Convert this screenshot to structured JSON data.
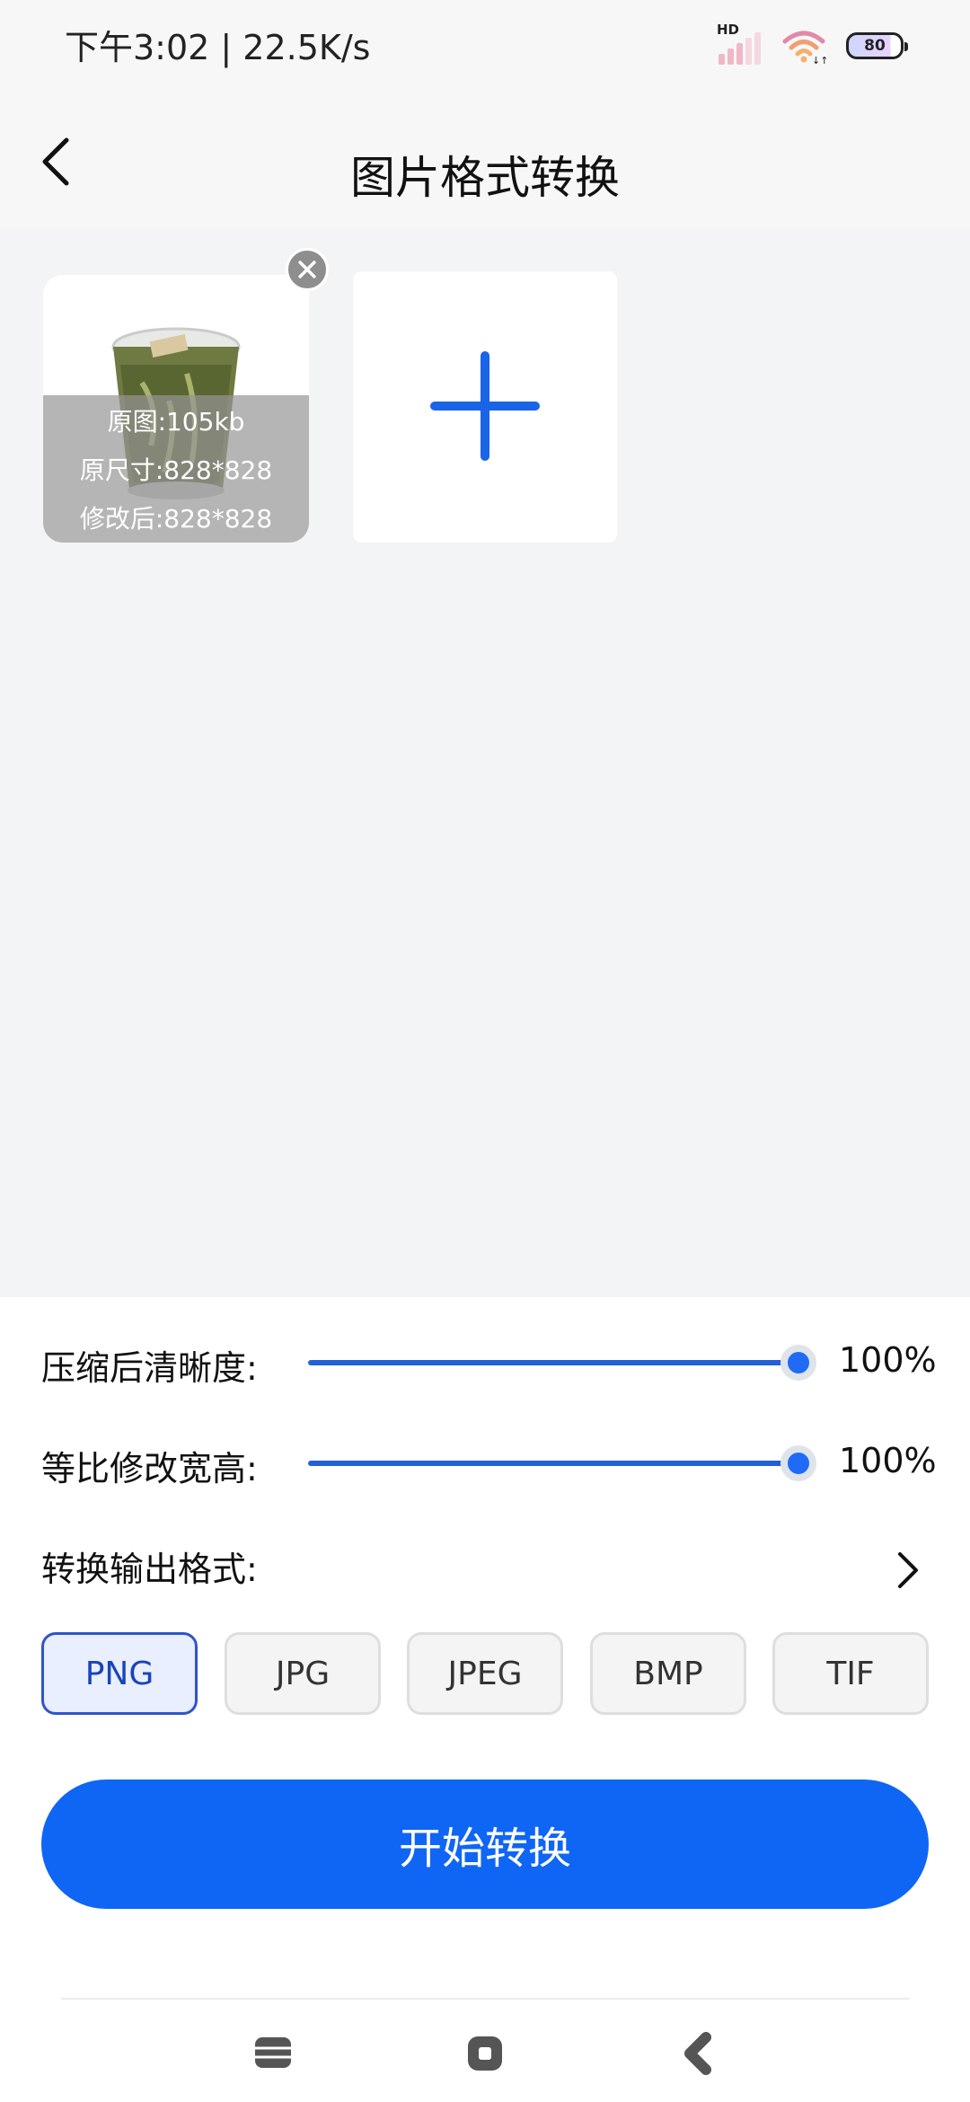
{
  "status_bar": {
    "time": "下午3:02 | 22.5K/s",
    "network_badge": "HD",
    "battery_level": "80"
  },
  "nav": {
    "title": "图片格式转换",
    "back_icon": "chevron-left-icon"
  },
  "images": [
    {
      "thumbnail": "glass-of-tea-photo",
      "original_size": "原图:105kb",
      "original_dimensions": "原尺寸:828*828",
      "modified_dimensions": "修改后:828*828"
    }
  ],
  "add_image_icon": "plus-icon",
  "settings": {
    "clarity": {
      "label": "压缩后清晰度:",
      "value": "100%",
      "level": 1.0
    },
    "scale": {
      "label": "等比修改宽高:",
      "value": "100%",
      "level": 1.0
    },
    "output_format": {
      "label": "转换输出格式:"
    }
  },
  "formats": {
    "selected": "PNG",
    "options": [
      "PNG",
      "JPG",
      "JPEG",
      "BMP",
      "TIF"
    ]
  },
  "start_button": "开始转换",
  "colors": {
    "accent": "#0F66F5",
    "page_bg": "#F3F4F6",
    "selected_border": "#2F55C8"
  }
}
